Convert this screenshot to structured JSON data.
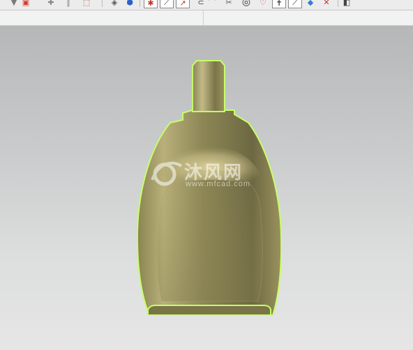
{
  "toolbar": {
    "buttons": [
      {
        "name": "filter-icon",
        "glyph": "▼"
      },
      {
        "name": "select-icon",
        "glyph": "▣"
      },
      {
        "name": "snap-point-icon",
        "glyph": "✚"
      },
      {
        "name": "snap-line-icon",
        "glyph": "‖"
      },
      {
        "name": "box-select-icon",
        "glyph": "⬚"
      },
      {
        "name": "wireframe-icon",
        "glyph": "◈"
      },
      {
        "name": "shaded-icon",
        "glyph": "⬢"
      },
      {
        "name": "feature-icon",
        "glyph": "✱"
      },
      {
        "name": "sketch-line-icon",
        "glyph": "⟋"
      },
      {
        "name": "sketch-arrow-icon",
        "glyph": "↗"
      },
      {
        "name": "arc-icon",
        "glyph": "⊂"
      },
      {
        "name": "curve-icon",
        "glyph": "⌒"
      },
      {
        "name": "trim-icon",
        "glyph": "✂"
      },
      {
        "name": "circle-icon",
        "glyph": "◎"
      },
      {
        "name": "heart-icon",
        "glyph": "♡"
      },
      {
        "name": "point-icon",
        "glyph": "✝"
      },
      {
        "name": "line-icon",
        "glyph": "⟋"
      },
      {
        "name": "plane-icon",
        "glyph": "◆"
      },
      {
        "name": "axis-icon",
        "glyph": "✕"
      },
      {
        "name": "view-icon",
        "glyph": "◧"
      }
    ]
  },
  "watermark": {
    "text": "沐风网",
    "url": "www.mfcad.com"
  },
  "colors": {
    "body_dark": "#6d6842",
    "body_light": "#cfc592",
    "edge_highlight": "#c6ff6a",
    "background_top": "#b5b7b8",
    "background_bottom": "#e6e6e6"
  }
}
